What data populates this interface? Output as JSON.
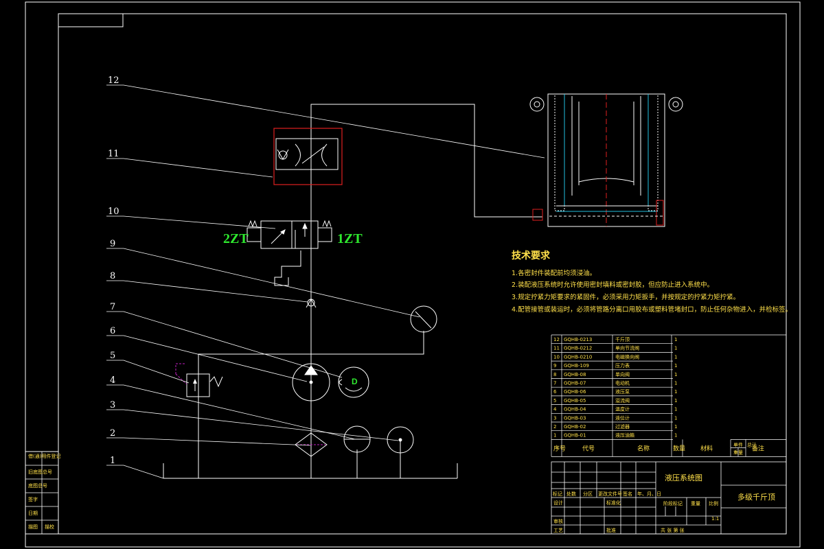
{
  "callouts": [
    "1",
    "2",
    "3",
    "4",
    "5",
    "6",
    "7",
    "8",
    "9",
    "10",
    "11",
    "12"
  ],
  "solenoids": {
    "left": "2ZT",
    "right": "1ZT"
  },
  "motor_label": "D",
  "tech_req": {
    "title": "技术要求",
    "items": [
      "1.各密封件装配前均须浸油。",
      "2.装配液压系统时允许使用密封填料或密封胶，但应防止进入系统中。",
      "3.规定拧紧力矩要求的紧固件，必须采用力矩扳手，并按规定的拧紧力矩拧紧。",
      "4.配管接管或装运时，必须将管路分离口用胶布或塑料管堵封口，防止任何杂物进入，并检标签。"
    ]
  },
  "bom": {
    "rows": [
      {
        "no": "12",
        "code": "GQHB-0213",
        "name": "千斤顶",
        "qty": "1"
      },
      {
        "no": "11",
        "code": "GQHB-0212",
        "name": "单向节流阀",
        "qty": "1"
      },
      {
        "no": "10",
        "code": "GQHB-0210",
        "name": "电磁换向阀",
        "qty": "1"
      },
      {
        "no": "9",
        "code": "GQHB-109",
        "name": "压力表",
        "qty": "1"
      },
      {
        "no": "8",
        "code": "GQHB-08",
        "name": "单向阀",
        "qty": "1"
      },
      {
        "no": "7",
        "code": "GQHB-07",
        "name": "电动机",
        "qty": "1"
      },
      {
        "no": "6",
        "code": "GQHB-06",
        "name": "液压泵",
        "qty": "1"
      },
      {
        "no": "5",
        "code": "GQHB-05",
        "name": "溢流阀",
        "qty": "1"
      },
      {
        "no": "4",
        "code": "GQHB-04",
        "name": "温度计",
        "qty": "1"
      },
      {
        "no": "3",
        "code": "GQHB-03",
        "name": "液位计",
        "qty": "1"
      },
      {
        "no": "2",
        "code": "GQHB-02",
        "name": "过滤器",
        "qty": "1"
      },
      {
        "no": "1",
        "code": "GQHB-01",
        "name": "液压油箱",
        "qty": "1"
      }
    ],
    "headers": {
      "no": "序号",
      "code": "代号",
      "name": "名称",
      "qty": "数量",
      "material": "材料",
      "unit": "单件",
      "total": "总计",
      "weight": "重量",
      "remark": "备注"
    }
  },
  "title_block": {
    "drawing_title": "液压系统图",
    "product_name": "多级千斤顶",
    "revision_headers": [
      "标记",
      "处数",
      "分区",
      "更改文件号",
      "签名",
      "年、月、日"
    ],
    "roles": {
      "design": "设计",
      "standard": "标准化",
      "review": "审核",
      "process": "工艺",
      "approve": "批准"
    },
    "stage_label": "阶段标记",
    "weight_label": "重量",
    "scale_label": "比例",
    "scale": "1:1",
    "sheets": "共  张  第  张"
  },
  "left_strip": [
    "借(通)用件登记",
    "旧底图总号",
    "底图总号",
    "签字",
    "日期"
  ],
  "left_strip_bottom": [
    "描图",
    "描校"
  ]
}
